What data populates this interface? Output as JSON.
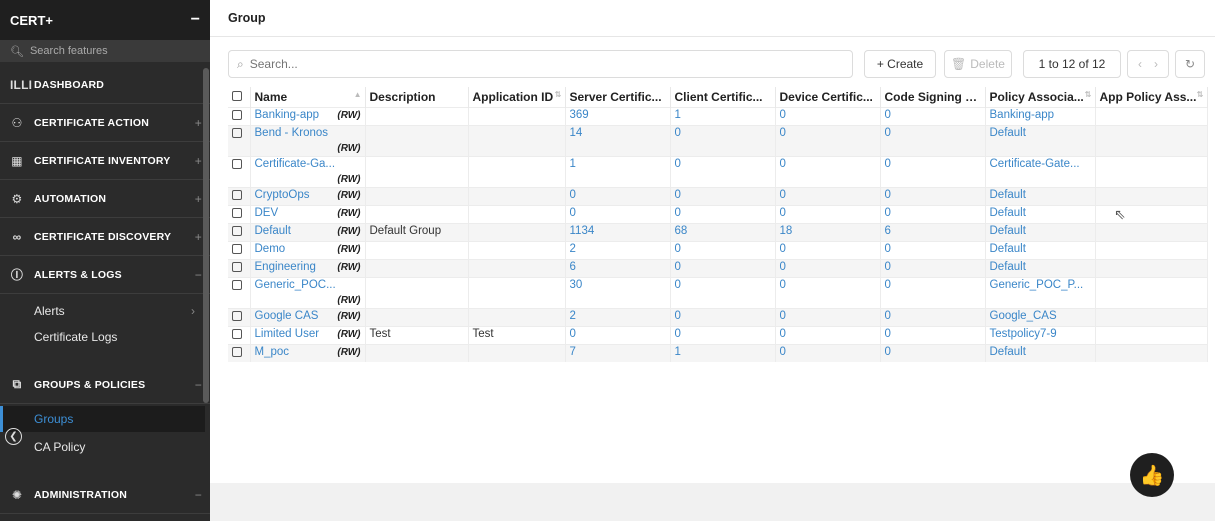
{
  "sidebar": {
    "brand": "CERT+",
    "collapse_glyph": "−",
    "search_placeholder": "Search features",
    "sections": [
      {
        "label": "DASHBOARD",
        "icon": "dashboard-icon",
        "glyph": "ıllı",
        "pm": ""
      },
      {
        "label": "CERTIFICATE ACTION",
        "icon": "certificate-action-icon",
        "glyph": "⚇",
        "pm": "+"
      },
      {
        "label": "CERTIFICATE INVENTORY",
        "icon": "inventory-icon",
        "glyph": "▦",
        "pm": "+"
      },
      {
        "label": "AUTOMATION",
        "icon": "automation-icon",
        "glyph": "⚙",
        "pm": "+"
      },
      {
        "label": "CERTIFICATE DISCOVERY",
        "icon": "discovery-icon",
        "glyph": "∞",
        "pm": "+"
      },
      {
        "label": "ALERTS & LOGS",
        "icon": "alerts-icon",
        "glyph": "ⓘ",
        "pm": "−"
      },
      {
        "label": "GROUPS & POLICIES",
        "icon": "groups-icon",
        "glyph": "⧉",
        "pm": "−"
      },
      {
        "label": "ADMINISTRATION",
        "icon": "administration-icon",
        "glyph": "✺",
        "pm": "−"
      }
    ],
    "alerts_sub": [
      {
        "label": "Alerts",
        "arrow": "›"
      },
      {
        "label": "Certificate Logs",
        "arrow": ""
      }
    ],
    "groups_sub": [
      {
        "label": "Groups"
      },
      {
        "label": "CA Policy"
      }
    ]
  },
  "page": {
    "title": "Group"
  },
  "toolbar": {
    "search_placeholder": "Search...",
    "create_label": "+ Create",
    "delete_label": "Delete",
    "pager_text": "1 to 12 of 12",
    "prev_glyph": "‹",
    "next_glyph": "›",
    "refresh_glyph": "↻"
  },
  "table": {
    "columns": [
      "Name",
      "Description",
      "Application ID",
      "Server Certific...",
      "Client Certific...",
      "Device Certific...",
      "Code Signing C...",
      "Policy Associa...",
      "App Policy Ass..."
    ],
    "rw_tag": "(RW)",
    "rows": [
      {
        "name": "Banking-app",
        "desc": "",
        "app": "",
        "server": "369",
        "client": "1",
        "device": "0",
        "code": "0",
        "policy": "Banking-app",
        "apppol": "",
        "tall": false,
        "rw_below": false
      },
      {
        "name": "Bend - Kronos",
        "desc": "",
        "app": "",
        "server": "14",
        "client": "0",
        "device": "0",
        "code": "0",
        "policy": "Default",
        "apppol": "",
        "tall": true,
        "rw_below": true
      },
      {
        "name": "Certificate-Ga...",
        "desc": "",
        "app": "",
        "server": "1",
        "client": "0",
        "device": "0",
        "code": "0",
        "policy": "Certificate-Gate...",
        "apppol": "",
        "tall": true,
        "rw_below": true
      },
      {
        "name": "CryptoOps",
        "desc": "",
        "app": "",
        "server": "0",
        "client": "0",
        "device": "0",
        "code": "0",
        "policy": "Default",
        "apppol": "",
        "tall": false,
        "rw_below": false
      },
      {
        "name": "DEV",
        "desc": "",
        "app": "",
        "server": "0",
        "client": "0",
        "device": "0",
        "code": "0",
        "policy": "Default",
        "apppol": "",
        "tall": false,
        "rw_below": false
      },
      {
        "name": "Default",
        "desc": "Default Group",
        "app": "",
        "server": "1134",
        "client": "68",
        "device": "18",
        "code": "6",
        "policy": "Default",
        "apppol": "",
        "tall": false,
        "rw_below": false
      },
      {
        "name": "Demo",
        "desc": "",
        "app": "",
        "server": "2",
        "client": "0",
        "device": "0",
        "code": "0",
        "policy": "Default",
        "apppol": "",
        "tall": false,
        "rw_below": false
      },
      {
        "name": "Engineering",
        "desc": "",
        "app": "",
        "server": "6",
        "client": "0",
        "device": "0",
        "code": "0",
        "policy": "Default",
        "apppol": "",
        "tall": false,
        "rw_below": false
      },
      {
        "name": "Generic_POC...",
        "desc": "",
        "app": "",
        "server": "30",
        "client": "0",
        "device": "0",
        "code": "0",
        "policy": "Generic_POC_P...",
        "apppol": "",
        "tall": true,
        "rw_below": true
      },
      {
        "name": "Google CAS",
        "desc": "",
        "app": "",
        "server": "2",
        "client": "0",
        "device": "0",
        "code": "0",
        "policy": "Google_CAS",
        "apppol": "",
        "tall": false,
        "rw_below": false
      },
      {
        "name": "Limited User",
        "desc": "Test",
        "app": "Test",
        "server": "0",
        "client": "0",
        "device": "0",
        "code": "0",
        "policy": "Testpolicy7-9",
        "apppol": "",
        "tall": false,
        "rw_below": false
      },
      {
        "name": "M_poc",
        "desc": "",
        "app": "",
        "server": "7",
        "client": "1",
        "device": "0",
        "code": "0",
        "policy": "Default",
        "apppol": "",
        "tall": false,
        "rw_below": false
      }
    ]
  },
  "feedback": {
    "glyph": "👍"
  }
}
